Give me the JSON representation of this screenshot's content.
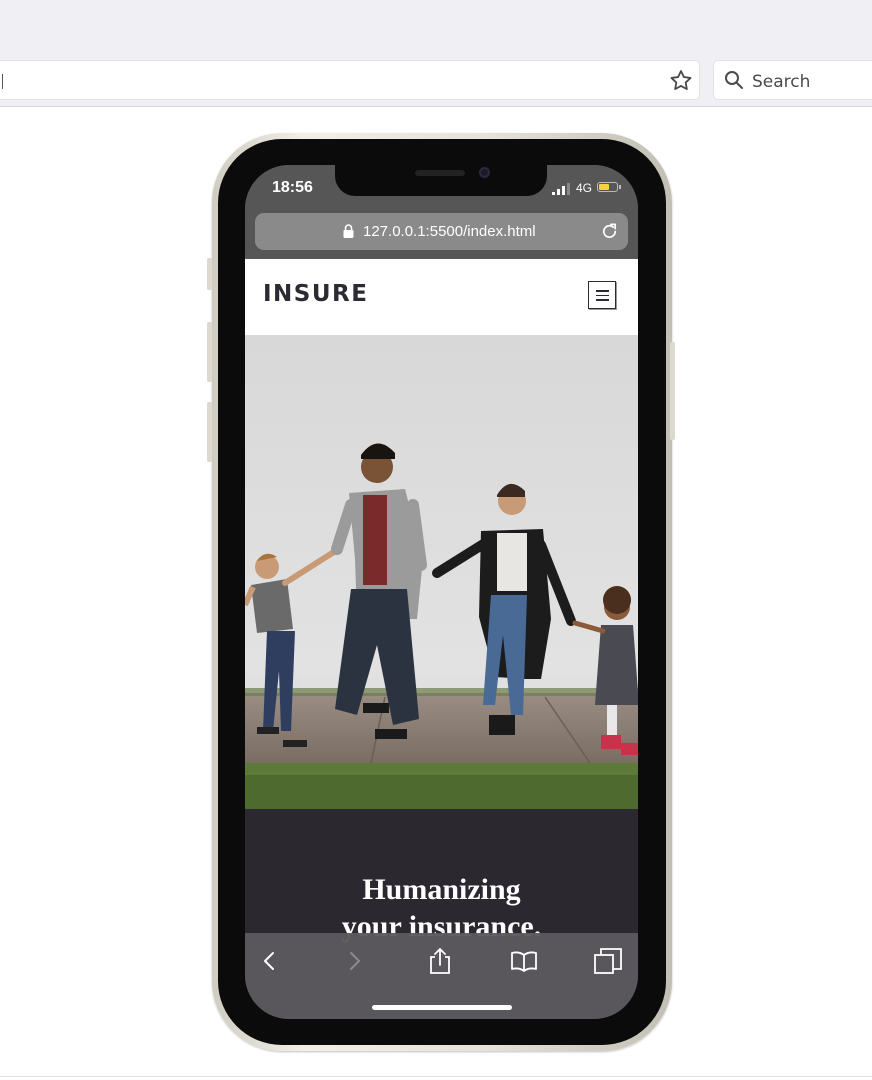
{
  "browser": {
    "search_label": "Search",
    "icons": [
      "star-icon",
      "search-icon"
    ]
  },
  "phone": {
    "status": {
      "time": "18:56",
      "network": "4G",
      "battery_level": 0.6,
      "battery_color": "#f7d23c"
    },
    "address": {
      "url": "127.0.0.1:5500/index.html"
    },
    "site": {
      "logo": "INSURE",
      "hero_title_line1": "Humanizing",
      "hero_title_line2": "your insurance.",
      "hero_bg_color": "#2c2830"
    },
    "toolbar_icons": [
      "back-icon",
      "forward-icon",
      "share-icon",
      "bookmarks-icon",
      "tabs-icon"
    ]
  }
}
